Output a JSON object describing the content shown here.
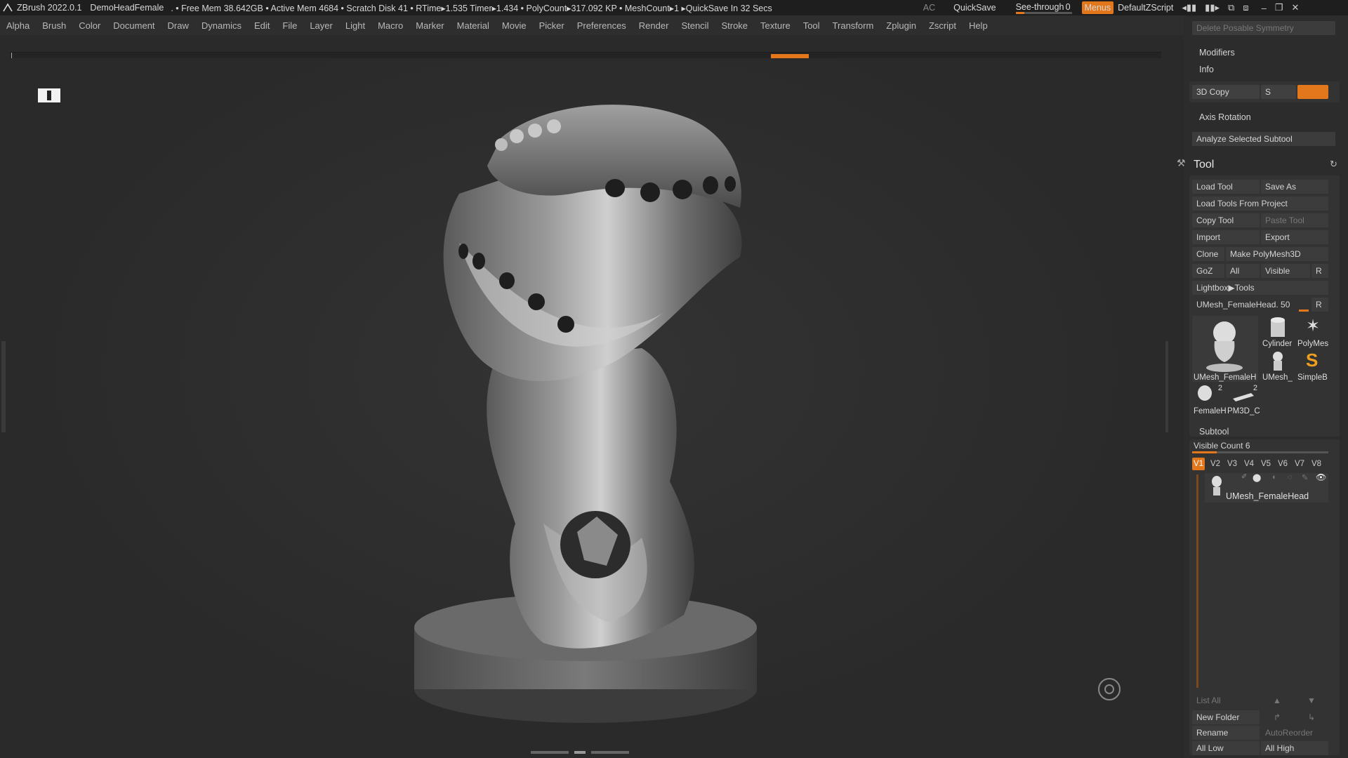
{
  "titlebar": {
    "app": "ZBrush 2022.0.1",
    "document": "DemoHeadFemale",
    "stats": ". • Free Mem 38.642GB • Active Mem 4684 • Scratch Disk 41 • RTime▸1.535 Timer▸1.434 • PolyCount▸317.092 KP • MeshCount▸1  ▸QuickSave In 32 Secs",
    "ac": "AC",
    "quicksave": "QuickSave",
    "see_through_label": "See-through",
    "see_through_value": "0",
    "see_through_level": 0,
    "menus": "Menus",
    "script": "DefaultZScript"
  },
  "menubar": {
    "items": [
      "Alpha",
      "Brush",
      "Color",
      "Document",
      "Draw",
      "Dynamics",
      "Edit",
      "File",
      "Layer",
      "Light",
      "Macro",
      "Marker",
      "Material",
      "Movie",
      "Picker",
      "Preferences",
      "Render",
      "Stencil",
      "Stroke",
      "Texture",
      "Tool",
      "Transform",
      "Zplugin",
      "Zscript",
      "Help"
    ]
  },
  "right_panel": {
    "top": {
      "delete_posable": "Delete Posable Symmetry",
      "modifiers": "Modifiers",
      "info": "Info",
      "copy3d": "3D Copy",
      "copy3d_s": "S",
      "axis_rotation": "Axis Rotation",
      "analyze": "Analyze Selected Subtool"
    },
    "tool": {
      "title": "Tool",
      "load_tool": "Load Tool",
      "save_as": "Save As",
      "load_from_project": "Load Tools From Project",
      "copy_tool": "Copy Tool",
      "paste_tool": "Paste Tool",
      "import": "Import",
      "export": "Export",
      "clone": "Clone",
      "make_polymesh": "Make PolyMesh3D",
      "goz": "GoZ",
      "all": "All",
      "visible": "Visible",
      "r": "R",
      "lightbox": "Lightbox▶Tools",
      "current_tool": "UMesh_FemaleHead. 50",
      "current_tool_r": "R",
      "thumbs": [
        {
          "label": "UMesh_FemaleH",
          "badge": ""
        },
        {
          "label": "Cylinder",
          "badge": ""
        },
        {
          "label": "PolyMes",
          "badge": ""
        },
        {
          "label": "UMesh_",
          "badge": ""
        },
        {
          "label": "SimpleB",
          "badge": ""
        },
        {
          "label": "FemaleH",
          "badge": "2"
        },
        {
          "label": "PM3D_C",
          "badge": "2"
        }
      ]
    },
    "subtool": {
      "title": "Subtool",
      "visible_count": "Visible Count 6",
      "visible_count_level": 0.18,
      "tabs": [
        "V1",
        "V2",
        "V3",
        "V4",
        "V5",
        "V6",
        "V7",
        "V8"
      ],
      "active_tab": "V1",
      "item_name": "UMesh_FemaleHead",
      "list_all": "List All",
      "new_folder": "New Folder",
      "rename": "Rename",
      "autoreorder": "AutoReorder",
      "all_low": "All Low",
      "all_high": "All High"
    }
  }
}
